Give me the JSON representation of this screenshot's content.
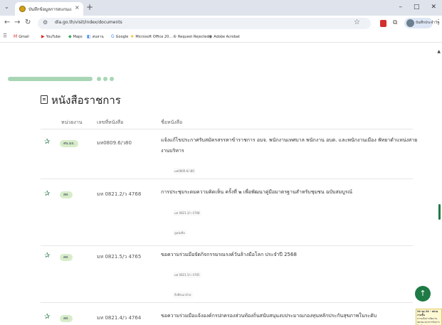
{
  "browser": {
    "tab_title": "บันทึกข้อมูลการสแกนเอกสาร",
    "url": "dla.go.th/visit/index/documents",
    "profile_name": "บันทึกประจำวัน",
    "bookmarks": [
      {
        "icon": "mail-icon",
        "label": "Gmail"
      },
      {
        "icon": "youtube-icon",
        "label": "YouTube"
      },
      {
        "icon": "maps-icon",
        "label": "Maps"
      },
      {
        "icon": "translate-icon",
        "label": "สนหาน"
      },
      {
        "icon": "google-icon",
        "label": "Google"
      },
      {
        "icon": "office-icon",
        "label": "Microsoft Office 20..."
      },
      {
        "icon": "link-icon",
        "label": "Request Rejected"
      },
      {
        "icon": "acrobat-icon",
        "label": "Adobe Acrobat"
      }
    ]
  },
  "page": {
    "title": "หนังสือราชการ",
    "columns": {
      "agency": "หน่วยงาน",
      "doc_no": "เลขที่หนังสือ",
      "subject": "ชื่อหนังสือ"
    },
    "rows": [
      {
        "agency": "สน.มถ.",
        "doc_no": "มท0809.6/ว80",
        "subject": "แจ้งแก้ไขประกาศรับสมัครสรรหาข้าราชการ อบจ. พนักงานเทศบาล พนักงาน อบต. และพนักงานเมือง พัทยาตำแหน่งสายงานบริหาร",
        "tags": [
          "มท0809.6/ว80"
        ]
      },
      {
        "agency": "สส.",
        "doc_no": "มท 0821.2/ว 4768",
        "subject": "การประชุมระดมความคิดเห็น ครั้งที่ ๒ เพื่อพัฒนาคู่มือมาตรฐานสำหรับชุมชน ฉบับสมบูรณ์",
        "tags": [
          "มท 0821.2/ว 4768",
          "ดูหนังสือ"
        ]
      },
      {
        "agency": "สส.",
        "doc_no": "มท 0821.5/ว 4765",
        "subject": "ขอความร่วมมือจัดกิจกรรมรณรงค์วันล้างมือโลก ประจำปี 2568",
        "tags": [
          "มท 0821.5/ว 4765",
          "สิ่งที่ส่งมาด้วย"
        ]
      },
      {
        "agency": "สส.",
        "doc_no": "มท 0821.4/ว 4764",
        "subject": "ขอความร่วมมือแจ้งองค์กรปกครองส่วนท้องถิ่นสนับสนุนงบประมาณกองทุนหลักประกันสุขภาพในระดับ",
        "tags": []
      }
    ],
    "note": {
      "title": "24 ขอ 24 - หน่วยงานชั้น",
      "text": "การแจ้งการจัดงานขยายเวลาการรับการจัดทำ"
    }
  }
}
